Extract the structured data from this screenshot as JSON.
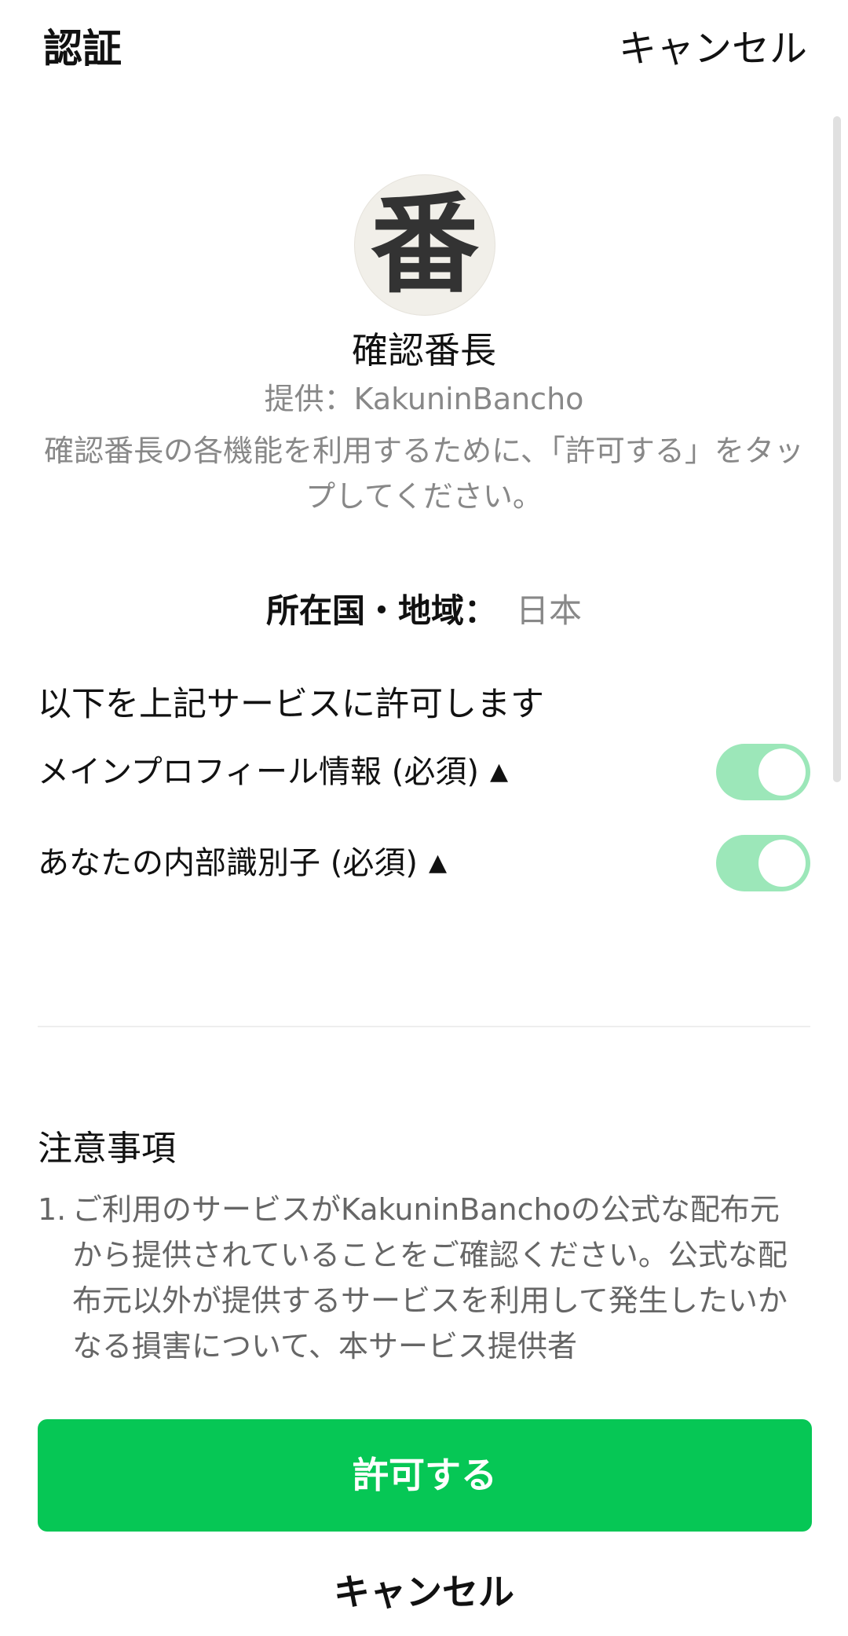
{
  "header": {
    "title": "認証",
    "cancel_label": "キャンセル"
  },
  "app": {
    "icon_char": "番",
    "name": "確認番長",
    "provider": "提供：KakuninBancho",
    "description": "確認番長の各機能を利用するために、「許可する」をタップしてください。"
  },
  "region": {
    "label": "所在国・地域：",
    "value": "日本"
  },
  "permissions": {
    "heading": "以下を上記サービスに許可します",
    "items": [
      {
        "label": "メインプロフィール情報 (必須)",
        "chevron": "▲",
        "enabled": true
      },
      {
        "label": "あなたの内部識別子 (必須)",
        "chevron": "▲",
        "enabled": true
      }
    ]
  },
  "notes": {
    "title": "注意事項",
    "items": [
      {
        "number": "1.",
        "text": "ご利用のサービスがKakuninBanchoの公式な配布元から提供されていることをご確認ください。公式な配布元以外が提供するサービスを利用して発生したいかなる損害について、本サービス提供者"
      }
    ]
  },
  "actions": {
    "allow_label": "許可する",
    "cancel_label": "キャンセル"
  },
  "colors": {
    "accent": "#06c755",
    "toggle_on": "#9ce7b9"
  }
}
